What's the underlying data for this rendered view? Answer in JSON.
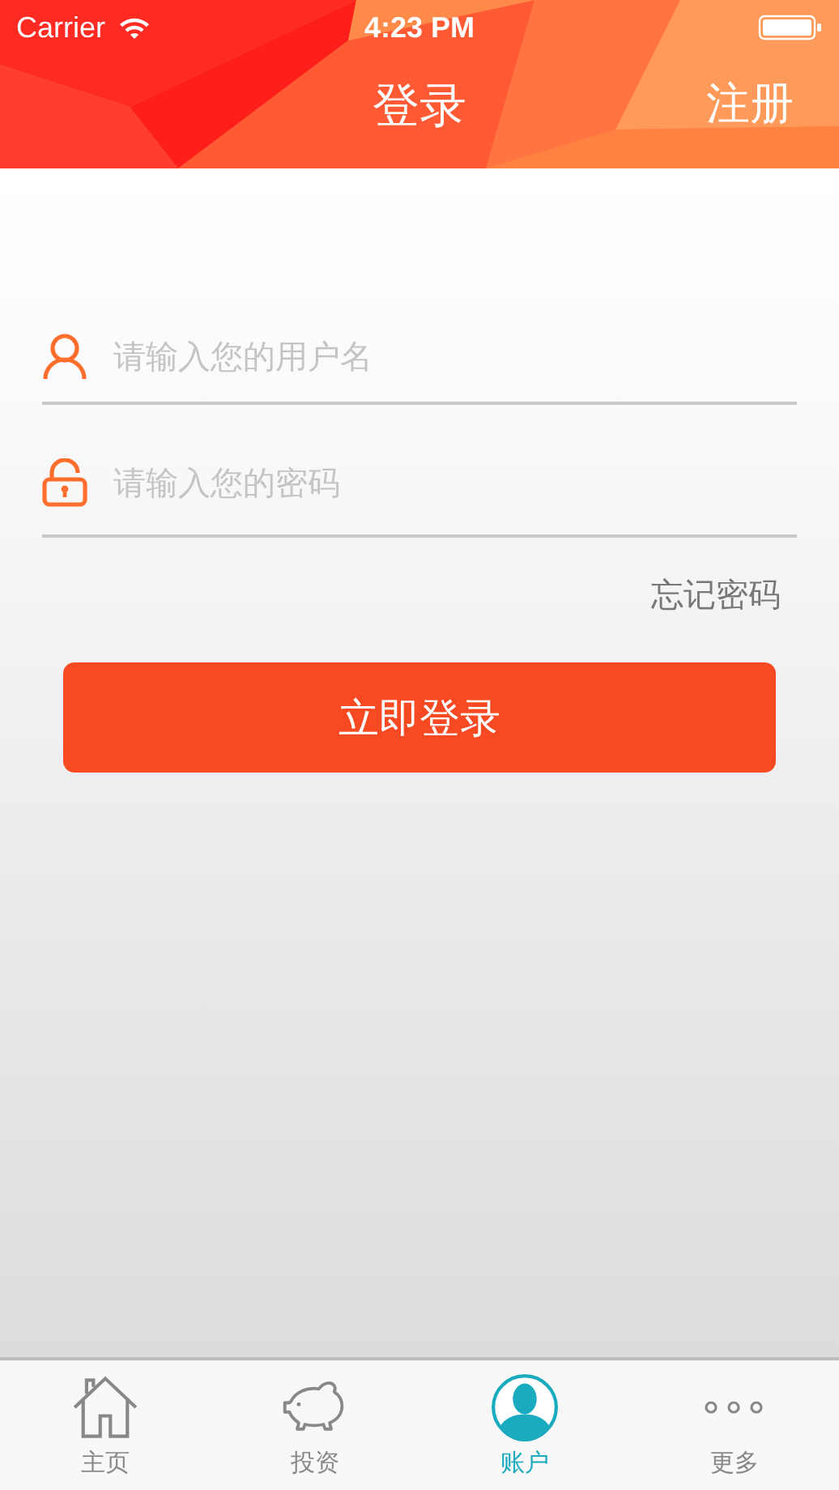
{
  "status_bar": {
    "carrier": "Carrier",
    "time": "4:23 PM"
  },
  "nav": {
    "title": "登录",
    "action": "注册"
  },
  "form": {
    "fields": [
      {
        "kind": "user",
        "placeholder": "请输入您的用户名"
      },
      {
        "kind": "lock",
        "placeholder": "请输入您的密码"
      }
    ],
    "forgot_link": "忘记密码",
    "submit": "立即登录"
  },
  "tab_bar": [
    {
      "kind": "home",
      "label": "主页",
      "selected": false
    },
    {
      "kind": "piggy",
      "label": "投资",
      "selected": false
    },
    {
      "kind": "account",
      "label": "账户",
      "selected": true
    },
    {
      "kind": "more",
      "label": "更多",
      "selected": false
    }
  ]
}
